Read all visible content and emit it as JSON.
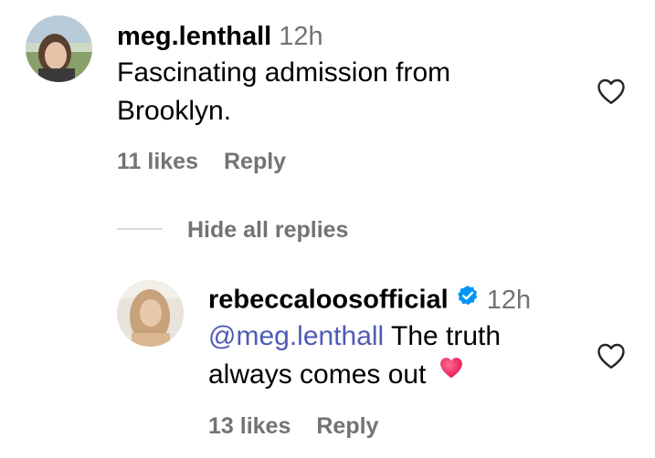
{
  "comment": {
    "username": "meg.lenthall",
    "time": "12h",
    "text_line1": "Fascinating admission from",
    "text_line2": "Brooklyn.",
    "likes": "11 likes",
    "reply_label": "Reply",
    "avatar_icon": "user-avatar",
    "like_icon": "heart-outline-icon"
  },
  "replies_toggle": {
    "label": "Hide all replies"
  },
  "reply": {
    "username": "rebeccaloosofficial",
    "verified_icon": "verified-badge-icon",
    "time": "12h",
    "mention": "@meg.lenthall",
    "text_line1": " The truth",
    "text_line2": "always comes out",
    "emoji": "red-heart-emoji",
    "likes": "13 likes",
    "reply_label": "Reply",
    "avatar_icon": "user-avatar",
    "like_icon": "heart-outline-icon"
  },
  "colors": {
    "text": "#000000",
    "secondary": "#737373",
    "mention": "#4e5bb5",
    "verified": "#0095f6",
    "divider": "#dbdbdb",
    "emoji_heart": "#e8265e"
  }
}
